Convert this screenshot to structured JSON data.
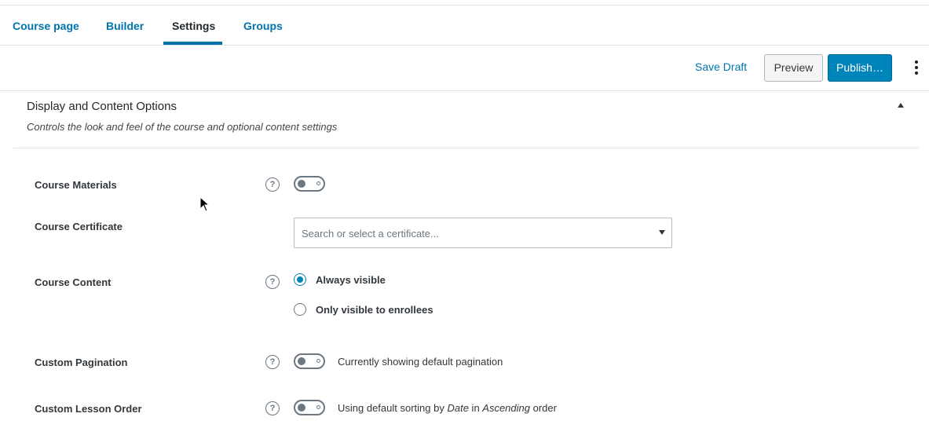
{
  "tabs": [
    {
      "label": "Course page",
      "active": false
    },
    {
      "label": "Builder",
      "active": false
    },
    {
      "label": "Settings",
      "active": true
    },
    {
      "label": "Groups",
      "active": false
    }
  ],
  "toolbar": {
    "save_draft": "Save Draft",
    "preview": "Preview",
    "publish": "Publish…",
    "more_icon": "kebab-menu-icon"
  },
  "panel": {
    "title": "Display and Content Options",
    "description": "Controls the look and feel of the course and optional content settings",
    "collapse_icon": "triangle-up-icon"
  },
  "settings": {
    "course_materials": {
      "label": "Course Materials",
      "toggle_on": false
    },
    "course_certificate": {
      "label": "Course Certificate",
      "placeholder": "Search or select a certificate..."
    },
    "course_content": {
      "label": "Course Content",
      "options": [
        {
          "label": "Always visible",
          "selected": true
        },
        {
          "label": "Only visible to enrollees",
          "selected": false
        }
      ]
    },
    "custom_pagination": {
      "label": "Custom Pagination",
      "toggle_on": false,
      "status": "Currently showing default pagination"
    },
    "custom_lesson_order": {
      "label": "Custom Lesson Order",
      "toggle_on": false,
      "status_prefix": "Using default sorting by ",
      "status_field": "Date",
      "status_mid": " in ",
      "status_order": "Ascending",
      "status_suffix": " order"
    }
  },
  "help_glyph": "?",
  "colors": {
    "accent": "#0073aa",
    "primary_button": "#0085ba",
    "toggle_gray": "#6c7781"
  }
}
